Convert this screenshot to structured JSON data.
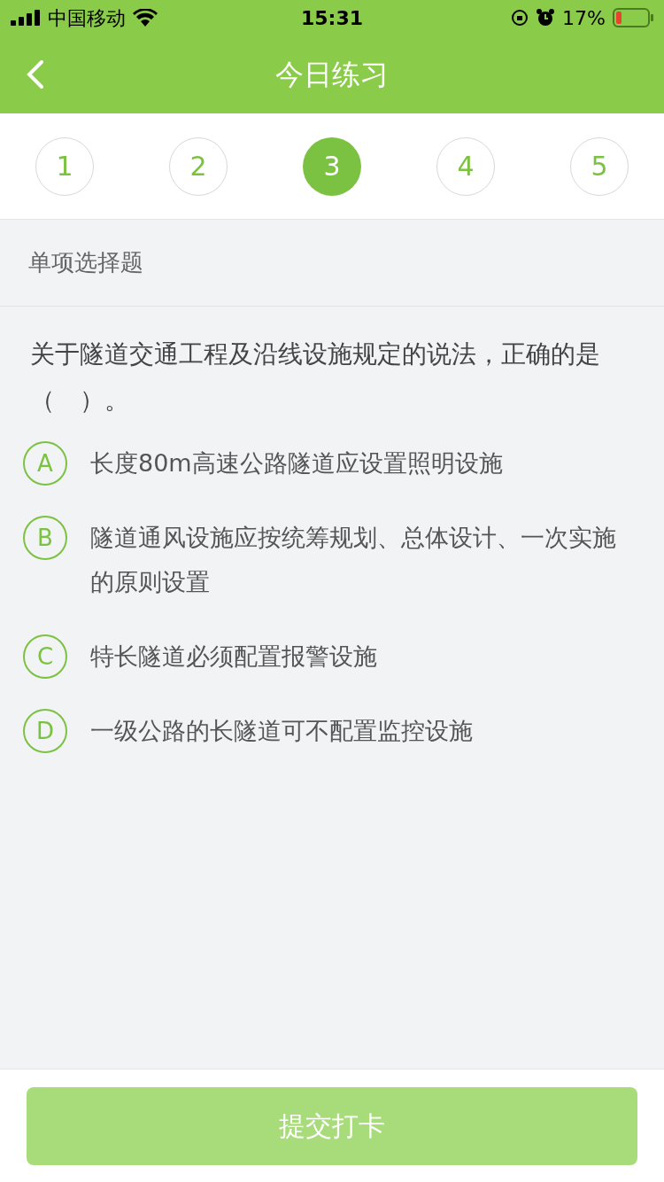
{
  "status_bar": {
    "carrier": "中国移动",
    "time": "15:31",
    "battery": "17%"
  },
  "header": {
    "title": "今日练习"
  },
  "steps": [
    {
      "label": "1",
      "selected": false
    },
    {
      "label": "2",
      "selected": false
    },
    {
      "label": "3",
      "selected": true
    },
    {
      "label": "4",
      "selected": false
    },
    {
      "label": "5",
      "selected": false
    }
  ],
  "question": {
    "type": "单项选择题",
    "text": "关于隧道交通工程及沿线设施规定的说法，正确的是（　）。",
    "options": [
      {
        "letter": "A",
        "text": "长度80m高速公路隧道应设置照明设施",
        "selected": false
      },
      {
        "letter": "B",
        "text": "隧道通风设施应按统筹规划、总体设计、一次实施的原则设置",
        "selected": false
      },
      {
        "letter": "C",
        "text": "特长隧道必须配置报警设施",
        "selected": false
      },
      {
        "letter": "D",
        "text": "一级公路的长隧道可不配置监控设施",
        "selected": false
      }
    ]
  },
  "submit": {
    "label": "提交打卡",
    "disabled": true
  }
}
